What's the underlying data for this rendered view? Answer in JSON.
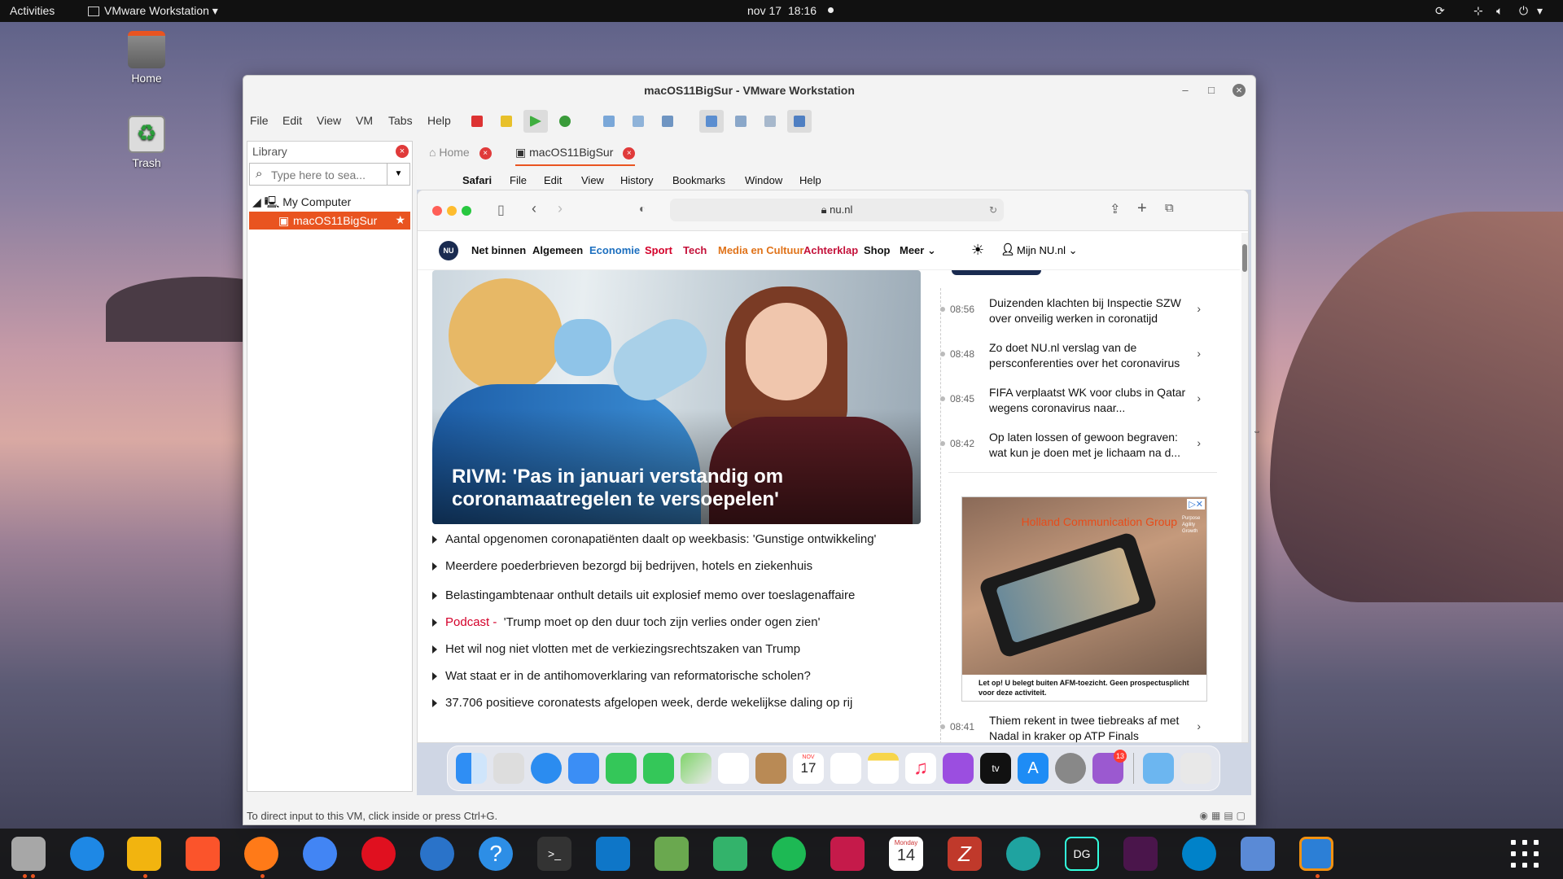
{
  "topbar": {
    "activities": "Activities",
    "app_menu": "VMware Workstation ▾",
    "date": "nov 17",
    "time": "18:16"
  },
  "desktop": {
    "icons": [
      {
        "label": "Home",
        "icon": "home-folder-icon"
      },
      {
        "label": "Trash",
        "icon": "trash-icon"
      }
    ]
  },
  "vmware": {
    "title": "macOS11BigSur - VMware Workstation",
    "menu": [
      "File",
      "Edit",
      "View",
      "VM",
      "Tabs",
      "Help"
    ],
    "library": {
      "title": "Library",
      "search_placeholder": "Type here to sea...",
      "tree_root": "My Computer",
      "tree_vm": "macOS11BigSur"
    },
    "tabs": {
      "home": "Home",
      "vm": "macOS11BigSur"
    },
    "status": "To direct input to this VM, click inside or press Ctrl+G."
  },
  "mac": {
    "menubar": [
      "Safari",
      "File",
      "Edit",
      "View",
      "History",
      "Bookmarks",
      "Window",
      "Help"
    ],
    "safari": {
      "url": "nu.nl",
      "nav": {
        "items": [
          {
            "label": "Net binnen",
            "color": "#111111"
          },
          {
            "label": "Algemeen",
            "color": "#111111"
          },
          {
            "label": "Economie",
            "color": "#1c6fbf"
          },
          {
            "label": "Sport",
            "color": "#d4002a"
          },
          {
            "label": "Tech",
            "color": "#c4113a"
          },
          {
            "label": "Media en Cultuur",
            "color": "#e0731a"
          },
          {
            "label": "Achterklap",
            "color": "#c4113a"
          },
          {
            "label": "Shop",
            "color": "#111111"
          },
          {
            "label": "Meer ⌄",
            "color": "#111111"
          }
        ],
        "account": "Mijn NU.nl ⌄"
      },
      "hero_title": "RIVM: 'Pas in januari verstandig om coronamaatregelen te versoepelen'",
      "articles": [
        "Aantal opgenomen coronapatiënten daalt op weekbasis: 'Gunstige ontwikkeling'",
        "Meerdere poederbrieven bezorgd bij bedrijven, hotels en ziekenhuis",
        "Belastingambtenaar onthult details uit explosief memo over toeslagenaffaire",
        "Het wil nog niet vlotten met de verkiezingsrechtszaken van Trump",
        "Wat staat er in de antihomoverklaring van reformatorische scholen?",
        "37.706 positieve coronatests afgelopen week, derde wekelijkse daling op rij"
      ],
      "podcast": {
        "tag": "Podcast -",
        "title": "'Trump moet op den duur toch zijn verlies onder ogen zien'"
      },
      "news_feed": [
        {
          "time": "08:56",
          "text": "Duizenden klachten bij Inspectie SZW over onveilig werken in coronatijd"
        },
        {
          "time": "08:48",
          "text": "Zo doet NU.nl verslag van de persconferenties over het coronavirus"
        },
        {
          "time": "08:45",
          "text": "FIFA verplaatst WK voor clubs in Qatar wegens coronavirus naar..."
        },
        {
          "time": "08:42",
          "text": "Op laten lossen of gewoon begraven: wat kun je doen met je lichaam na d..."
        },
        {
          "time": "08:41",
          "text": "Thiem rekent in twee tiebreaks af met Nadal in kraker op ATP Finals"
        }
      ],
      "ad": {
        "brand": "Holland Communication Group",
        "tagline": "Purpose Agility Growth",
        "disclaimer": "Let op! U belegt buiten AFM-toezicht. Geen prospectusplicht voor deze activiteit."
      }
    },
    "dock": {
      "calendar_month": "NOV",
      "calendar_day": "17",
      "feedback_badge": "13"
    }
  },
  "ubuntu_dock": {
    "calendar_day_label": "Monday",
    "calendar_day": "14"
  }
}
